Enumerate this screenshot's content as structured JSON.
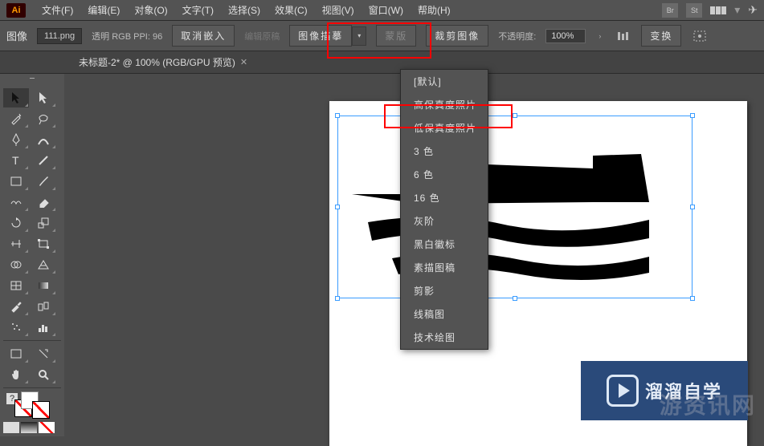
{
  "app": {
    "logo": "Ai"
  },
  "menu": {
    "file": "文件(F)",
    "edit": "编辑(E)",
    "object": "对象(O)",
    "type": "文字(T)",
    "select": "选择(S)",
    "effect": "效果(C)",
    "view": "视图(V)",
    "window": "窗口(W)",
    "help": "帮助(H)"
  },
  "menubar_icons": {
    "br": "Br",
    "st": "St"
  },
  "options": {
    "label": "图像",
    "filename": "111.png",
    "info": "透明 RGB PPI: 96",
    "unembed": "取消嵌入",
    "edit_original": "编辑原稿",
    "image_trace": "图像描摹",
    "mask": "蒙版",
    "crop": "裁剪图像",
    "opacity_label": "不透明度:",
    "opacity_value": "100%",
    "transform": "变换"
  },
  "tab": {
    "title": "未标题-2* @ 100% (RGB/GPU 预览)"
  },
  "dropdown": {
    "items": [
      "[默认]",
      "高保真度照片",
      "低保真度照片",
      "3 色",
      "6 色",
      "16 色",
      "灰阶",
      "黑白徽标",
      "素描图稿",
      "剪影",
      "线稿图",
      "技术绘图"
    ]
  },
  "watermark": {
    "text": "溜溜自学"
  },
  "watermark_faded": "游资讯网"
}
